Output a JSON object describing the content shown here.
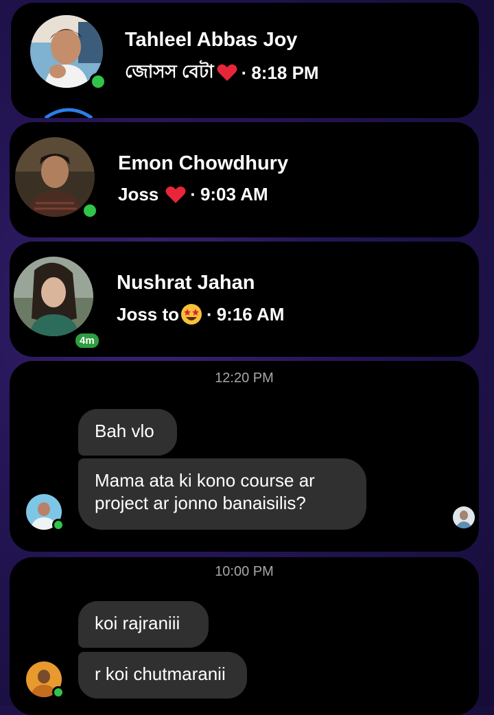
{
  "conversations": [
    {
      "name": "Tahleel Abbas Joy",
      "preview_text": "জোসস বেটা",
      "preview_emoji": "heart-emoji",
      "separator": "·",
      "time": "8:18 PM",
      "online": true
    },
    {
      "name": "Emon Chowdhury",
      "preview_text": "Joss",
      "preview_emoji": "heart-emoji",
      "separator": "·",
      "time": "9:03 AM",
      "online": true
    },
    {
      "name": "Nushrat Jahan",
      "preview_text": "Joss to",
      "preview_emoji": "star-struck-emoji",
      "separator": "·",
      "time": "9:16 AM",
      "active_badge": "4m"
    }
  ],
  "message_groups": [
    {
      "timestamp": "12:20 PM",
      "messages": [
        "Bah vlo",
        "Mama ata ki kono course ar\nproject ar jonno banaisilis?"
      ]
    },
    {
      "timestamp": "10:00 PM",
      "messages": [
        "koi rajraniii",
        "r koi chutmaranii"
      ]
    }
  ],
  "colors": {
    "card_background": "#000000",
    "bubble_background": "#303030",
    "online_green": "#31c44a",
    "timestamp_gray": "#a7a7a7",
    "page_background": "#251556"
  }
}
